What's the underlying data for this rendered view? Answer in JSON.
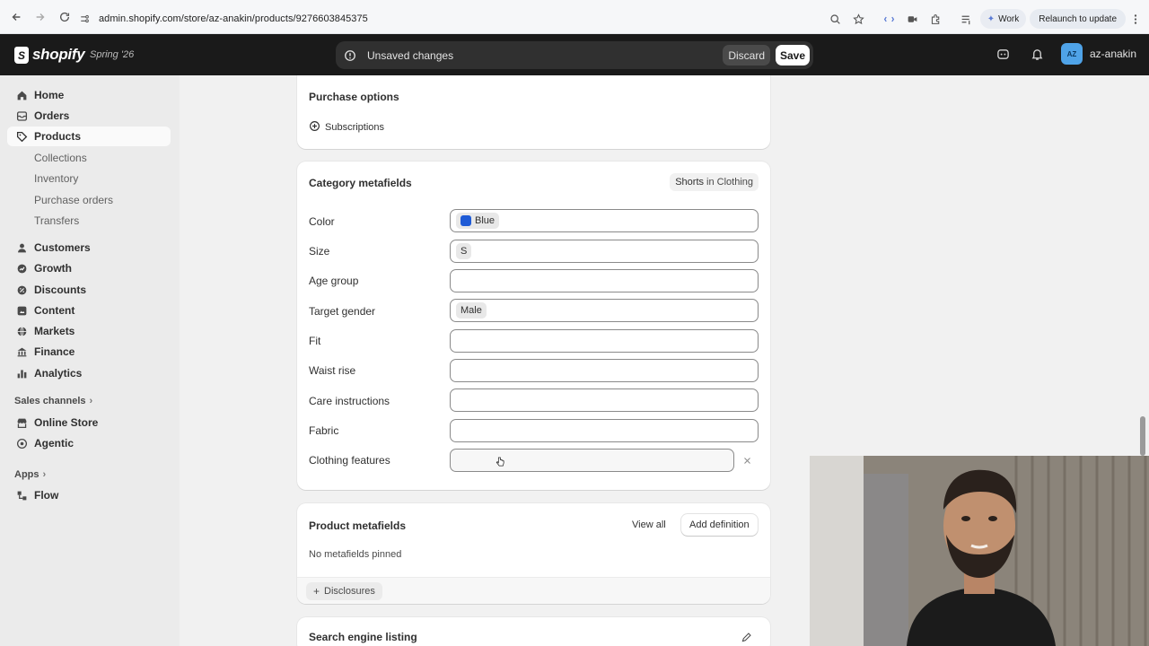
{
  "browser": {
    "url": "admin.shopify.com/store/az-anakin/products/9276603845375",
    "work_label": "Work",
    "relaunch_label": "Relaunch to update"
  },
  "topbar": {
    "logo_text": "shopify",
    "edition": "Spring '26",
    "unsaved_text": "Unsaved changes",
    "discard_label": "Discard",
    "save_label": "Save",
    "avatar_initials": "AZ",
    "store_name": "az-anakin",
    "avatar_color": "#4fa3e8"
  },
  "sidebar": {
    "items": [
      {
        "label": "Home",
        "icon": "home-icon"
      },
      {
        "label": "Orders",
        "icon": "orders-icon"
      },
      {
        "label": "Products",
        "icon": "tag-icon",
        "active": true
      }
    ],
    "product_subitems": [
      "Collections",
      "Inventory",
      "Purchase orders",
      "Transfers"
    ],
    "items2": [
      {
        "label": "Customers",
        "icon": "person-icon"
      },
      {
        "label": "Growth",
        "icon": "growth-icon"
      },
      {
        "label": "Discounts",
        "icon": "discount-icon"
      },
      {
        "label": "Content",
        "icon": "content-icon"
      },
      {
        "label": "Markets",
        "icon": "globe-icon"
      },
      {
        "label": "Finance",
        "icon": "bank-icon"
      },
      {
        "label": "Analytics",
        "icon": "chart-icon"
      }
    ],
    "sales_channels_label": "Sales channels",
    "channels": [
      {
        "label": "Online Store",
        "icon": "store-icon"
      },
      {
        "label": "Agentic",
        "icon": "agentic-icon"
      }
    ],
    "apps_label": "Apps",
    "apps": [
      {
        "label": "Flow",
        "icon": "flow-icon"
      }
    ]
  },
  "purchase_options": {
    "title": "Purchase options",
    "subscriptions_label": "Subscriptions"
  },
  "category_metafields": {
    "title": "Category metafields",
    "badge_main": "Shorts",
    "badge_rest": "in Clothing",
    "fields": [
      {
        "label": "Color",
        "value": "Blue",
        "swatch": "#1f5bd6"
      },
      {
        "label": "Size",
        "value": "S"
      },
      {
        "label": "Age group",
        "value": ""
      },
      {
        "label": "Target gender",
        "value": "Male"
      },
      {
        "label": "Fit",
        "value": ""
      },
      {
        "label": "Waist rise",
        "value": ""
      },
      {
        "label": "Care instructions",
        "value": ""
      },
      {
        "label": "Fabric",
        "value": ""
      },
      {
        "label": "Clothing features",
        "value": ""
      }
    ]
  },
  "product_metafields": {
    "title": "Product metafields",
    "view_all_label": "View all",
    "add_definition_label": "Add definition",
    "empty_text": "No metafields pinned",
    "disclosures_label": "Disclosures"
  },
  "seo": {
    "title": "Search engine listing"
  }
}
